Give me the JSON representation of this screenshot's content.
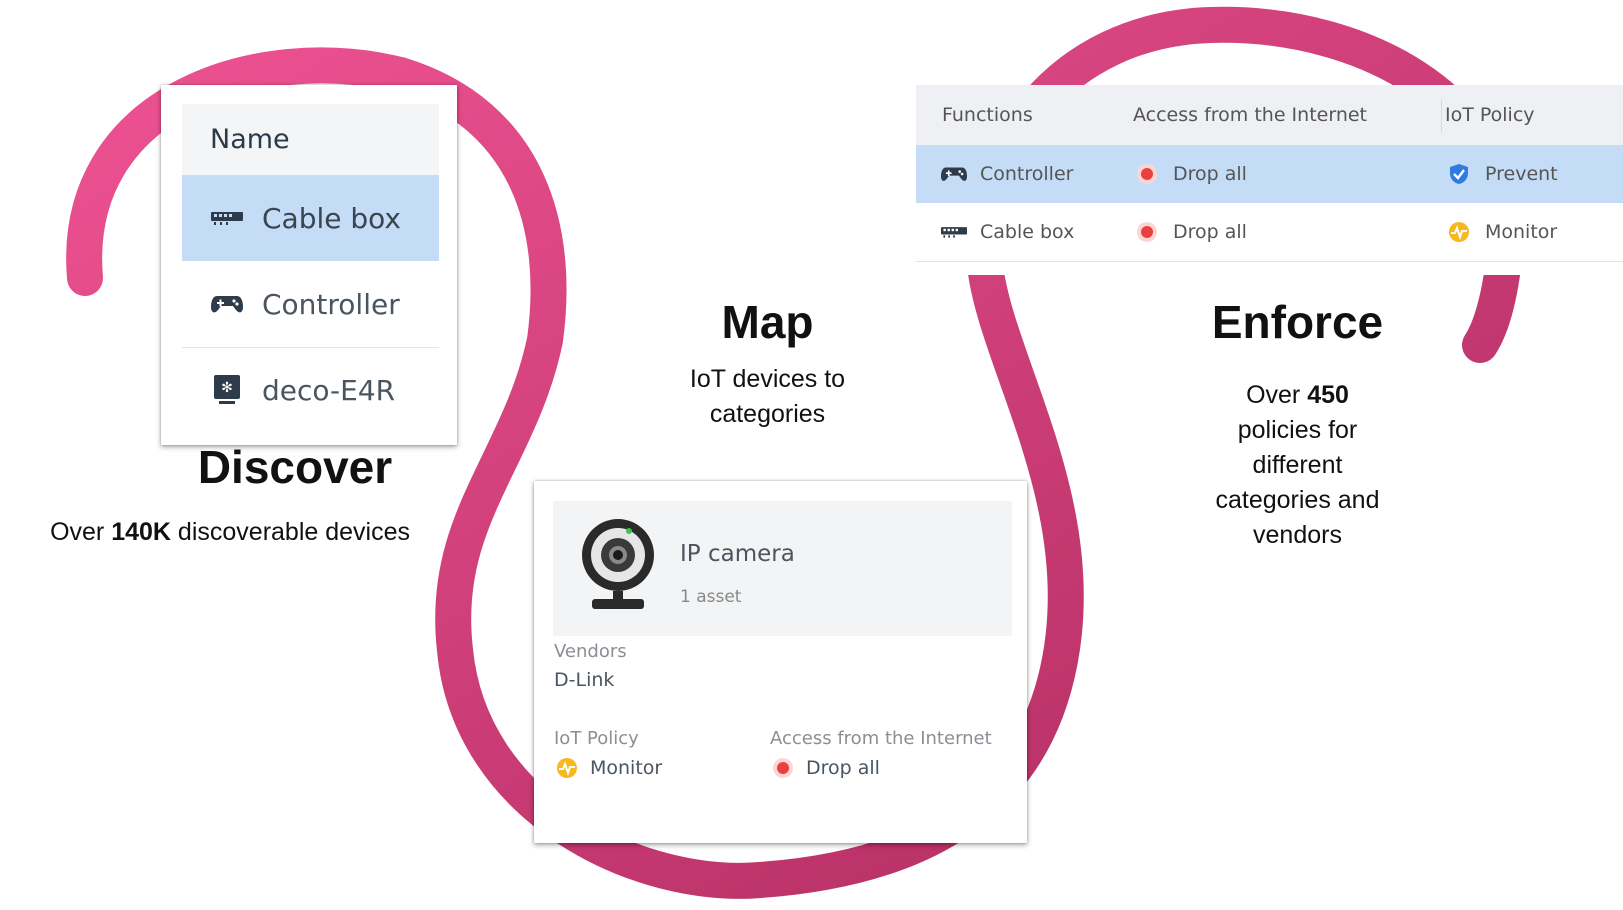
{
  "colors": {
    "ribbon_start": "#ef5393",
    "ribbon_end": "#ad2a5e",
    "selected_row": "#c4dcf6",
    "drop_red": "#e8413f",
    "monitor_yellow": "#f5b820",
    "prevent_blue": "#2f7ce0"
  },
  "discover": {
    "heading": "Discover",
    "desc_prefix": "Over",
    "desc_bold": "140K",
    "desc_suffix": "discoverable devices",
    "card": {
      "header": "Name",
      "rows": [
        {
          "label": "Cable box",
          "icon": "cable-box-icon",
          "selected": true
        },
        {
          "label": "Controller",
          "icon": "gamepad-icon",
          "selected": false
        },
        {
          "label": "deco-E4R",
          "icon": "router-icon",
          "selected": false
        }
      ]
    }
  },
  "map": {
    "heading": "Map",
    "desc_line1": "IoT devices to",
    "desc_line2": "categories",
    "card": {
      "title": "IP camera",
      "subtitle": "1 asset",
      "vendors_label": "Vendors",
      "vendors_value": "D-Link",
      "policy_label": "IoT Policy",
      "policy_value": "Monitor",
      "access_label": "Access from the Internet",
      "access_value": "Drop all"
    }
  },
  "enforce": {
    "heading": "Enforce",
    "desc_line1_prefix": "Over",
    "desc_line1_bold": "450",
    "desc_line2": "policies for",
    "desc_line3": "different",
    "desc_line4": "categories and",
    "desc_line5": "vendors",
    "table": {
      "columns": [
        "Functions",
        "Access from the Internet",
        "IoT Policy"
      ],
      "rows": [
        {
          "function": "Controller",
          "function_icon": "gamepad-icon",
          "access": "Drop all",
          "policy": "Prevent",
          "policy_icon": "shield-check-icon",
          "selected": true
        },
        {
          "function": "Cable box",
          "function_icon": "cable-box-icon",
          "access": "Drop all",
          "policy": "Monitor",
          "policy_icon": "pulse-icon",
          "selected": false
        }
      ]
    }
  }
}
